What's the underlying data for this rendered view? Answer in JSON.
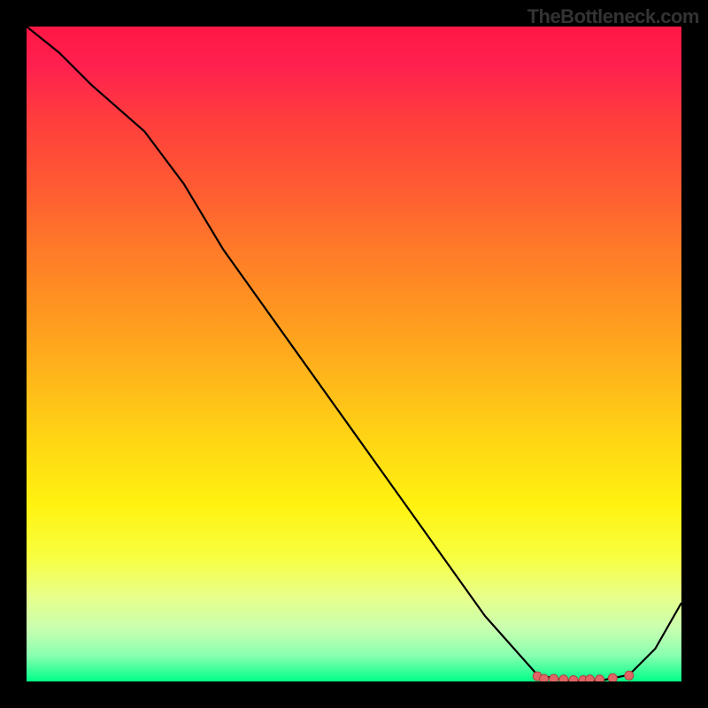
{
  "watermark": "TheBottleneck.com",
  "chart_data": {
    "type": "line",
    "title": "",
    "xlabel": "",
    "ylabel": "",
    "xlim": [
      0,
      100
    ],
    "ylim": [
      0,
      100
    ],
    "x": [
      0,
      5,
      10,
      18,
      24,
      30,
      40,
      50,
      60,
      70,
      78,
      82,
      85,
      88,
      92,
      96,
      100
    ],
    "values": [
      100,
      96,
      91,
      84,
      76,
      66,
      52,
      38,
      24,
      10,
      1,
      0.2,
      0.1,
      0.2,
      1,
      5,
      12
    ],
    "marker_points": {
      "x": [
        78,
        79,
        80.5,
        82,
        83.5,
        85,
        86,
        87.5,
        89.5,
        92
      ],
      "y": [
        0.8,
        0.4,
        0.4,
        0.3,
        0.2,
        0.2,
        0.3,
        0.3,
        0.5,
        0.9
      ]
    },
    "gradient_colors": {
      "top": "#ff1744",
      "mid_high": "#ff9820",
      "mid_low": "#fff210",
      "bottom": "#00ff88"
    },
    "line_color": "#000000",
    "marker_color": "#e06666"
  }
}
